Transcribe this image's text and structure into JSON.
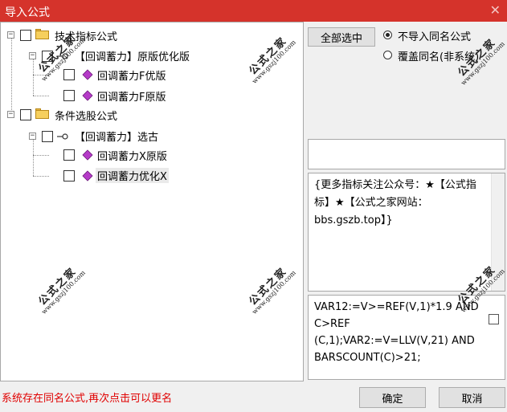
{
  "window": {
    "title": "导入公式",
    "close_glyph": "✕"
  },
  "tree": {
    "nodes": [
      {
        "label": "技术指标公式"
      },
      {
        "label": "【回调蓄力】原版优化版"
      },
      {
        "label": "回调蓄力F优版"
      },
      {
        "label": "回调蓄力F原版"
      },
      {
        "label": "条件选股公式"
      },
      {
        "label": "【回调蓄力】选古"
      },
      {
        "label": "回调蓄力X原版"
      },
      {
        "label": "回调蓄力优化X"
      }
    ],
    "expander_glyph": "−"
  },
  "right": {
    "select_all_label": "全部选中",
    "radio_no_import_label": "不导入同名公式",
    "radio_overwrite_label": "覆盖同名(非系统)",
    "description": "{更多指标关注公众号：★【公式指标】★【公式之家网站：bbs.gszb.top】}",
    "code": "VAR12:=V>=REF(V,1)*1.9 AND C>REF (C,1);VAR2:=V=LLV(V,21) AND BARSCOUNT(C)>21;"
  },
  "footer": {
    "status": "系统存在同名公式,再次点击可以更名",
    "ok_label": "确定",
    "cancel_label": "取消"
  },
  "watermark": {
    "big": "公式之家",
    "small": "www.gszj100.com"
  },
  "colors": {
    "titlebar": "#d5332b",
    "status_text": "#e00000",
    "diamond": "#b53bc8"
  }
}
